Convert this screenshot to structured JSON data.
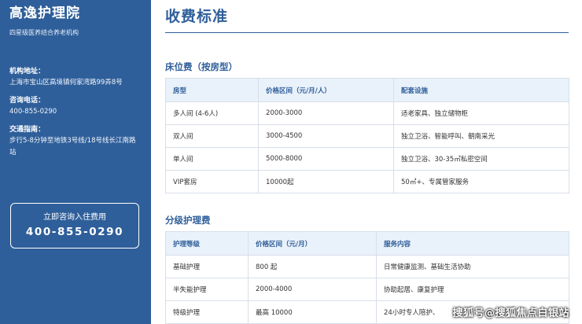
{
  "sidebar": {
    "brand": "高逸护理院",
    "tagline": "四星级医养结合养老机构",
    "address_label": "机构地址：",
    "address_value": "上海市宝山区高境镇何家湾路99弄8号",
    "phone_label": "咨询电话：",
    "phone_value": "400-855-0290",
    "transport_label": "交通指南：",
    "transport_value": "步行5-8分钟至地铁3号线/18号线长江南路站",
    "cta_label": "立即咨询入住费用",
    "cta_phone": "400-855-0290"
  },
  "main": {
    "page_title": "收费标准",
    "bed_section": {
      "title": "床位费（按房型）",
      "headers": [
        "房型",
        "价格区间（元/月/人）",
        "配套设施"
      ],
      "rows": [
        [
          "多人间 (4-6人)",
          "2000-3000",
          "适老家具、独立储物柜"
        ],
        [
          "双人间",
          "3000-4500",
          "独立卫浴、智能呼叫、朝南采光"
        ],
        [
          "单人间",
          "5000-8000",
          "独立卫浴、30-35㎡私密空间"
        ],
        [
          "VIP套房",
          "10000起",
          "50㎡+、专属管家服务"
        ]
      ]
    },
    "care_section": {
      "title": "分级护理费",
      "headers": [
        "护理等级",
        "价格区间（元/月）",
        "服务内容"
      ],
      "rows": [
        [
          "基础护理",
          "800 起",
          "日常健康监测、基础生活协助"
        ],
        [
          "半失能护理",
          "2000-4000",
          "协助起居、康复护理"
        ],
        [
          "特级护理",
          "最高 10000",
          "24小时专人陪护、"
        ]
      ]
    }
  },
  "watermark": "搜狐号@搜狐焦点白银站",
  "colors": {
    "brand_blue": "#2f5f9a",
    "header_bg": "#e9f1fa",
    "border": "#d8dfe9"
  }
}
